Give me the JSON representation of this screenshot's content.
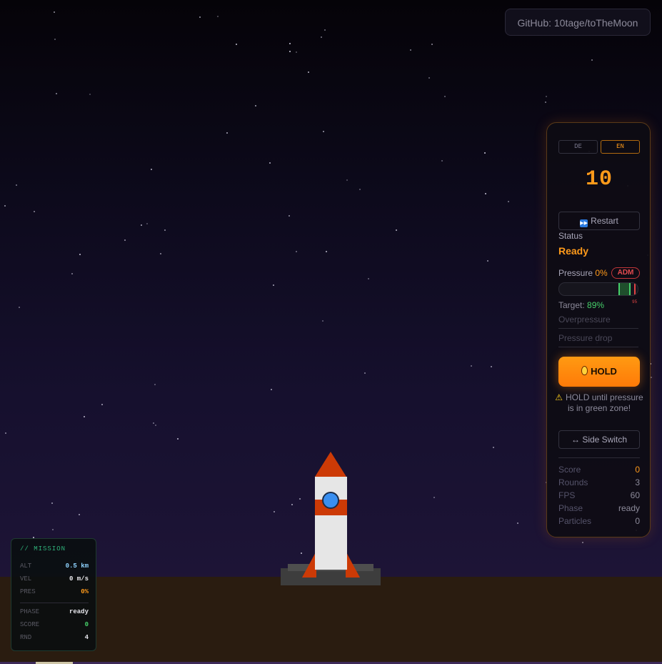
{
  "github": {
    "label": "GitHub: 10tage/toTheMoon"
  },
  "controls": {
    "lang_de": "DE",
    "lang_en": "EN",
    "countdown": "10",
    "restart_label": "Restart",
    "status_label": "Status",
    "status_value": "Ready",
    "pressure_label": "Pressure",
    "pressure_value": "0%",
    "pressure_fraction": 0,
    "adm_badge": "ADM",
    "target_zone_low_fraction": 0.75,
    "target_zone_high_fraction": 0.89,
    "danger_fraction": 0.95,
    "limit_marker_text": "95",
    "target_label": "Target:",
    "target_value": "89%",
    "overpressure_label": "Overpressure",
    "pressure_drop_label": "Pressure drop",
    "hold_label": "HOLD",
    "hint_text": "HOLD until pressure",
    "hint_text_2": "is in green zone!",
    "side_switch_label": "↔ Side Switch",
    "stats": [
      {
        "label": "Score",
        "value": "0"
      },
      {
        "label": "Rounds",
        "value": "3"
      },
      {
        "label": "FPS",
        "value": "60"
      },
      {
        "label": "Phase",
        "value": "ready"
      },
      {
        "label": "Particles",
        "value": "0"
      }
    ]
  },
  "mission": {
    "title": "// MISSION",
    "alt_label": "ALT",
    "alt_value": "0.5 km",
    "vel_label": "VEL",
    "vel_value": "0 m/s",
    "pres_label": "PRES",
    "pres_value": "0%",
    "phase_label": "PHASE",
    "phase_value": "ready",
    "score_label": "SCORE",
    "score_value": "0",
    "rnd_label": "RND",
    "rnd_value": "4"
  },
  "colors": {
    "accent": "#ff9a1a",
    "ok": "#46d06a",
    "danger": "#e34444",
    "velocity_value": "#e8e8ee",
    "alt_value": "#8fd3ff",
    "mission_title": "#2fb07a"
  }
}
